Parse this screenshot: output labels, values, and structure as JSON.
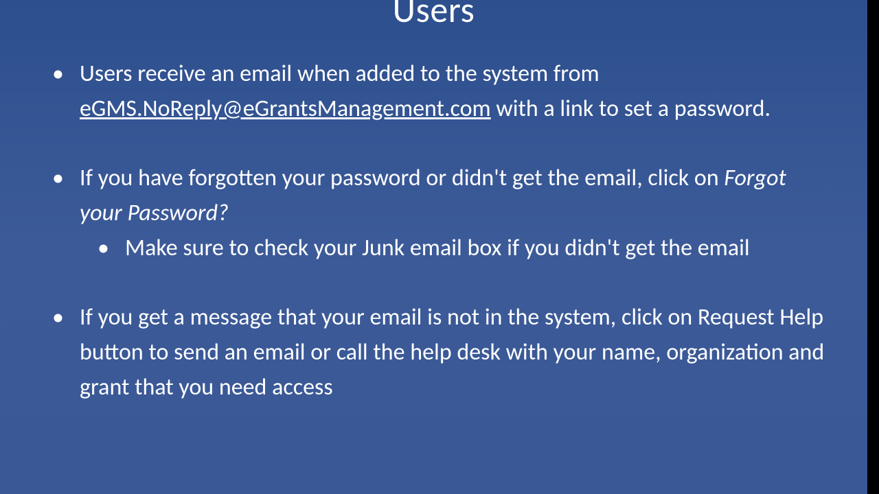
{
  "slide": {
    "title": "Users",
    "bullets": {
      "b1_pre": "Users receive an email when added to the system from ",
      "b1_email": "eGMS.NoReply@eGrantsManagement.com",
      "b1_post": " with a link to set a password.",
      "b2_pre": "If you have forgotten your password or didn't get the email, click on ",
      "b2_italic": "Forgot your Password?",
      "b2_sub1": "Make sure to check your Junk email box if you didn't get the email",
      "b3": "If you get a message that your email is not in the system, click on Request Help button to send an email or call the help desk with your name, organization and grant that you need access"
    }
  }
}
